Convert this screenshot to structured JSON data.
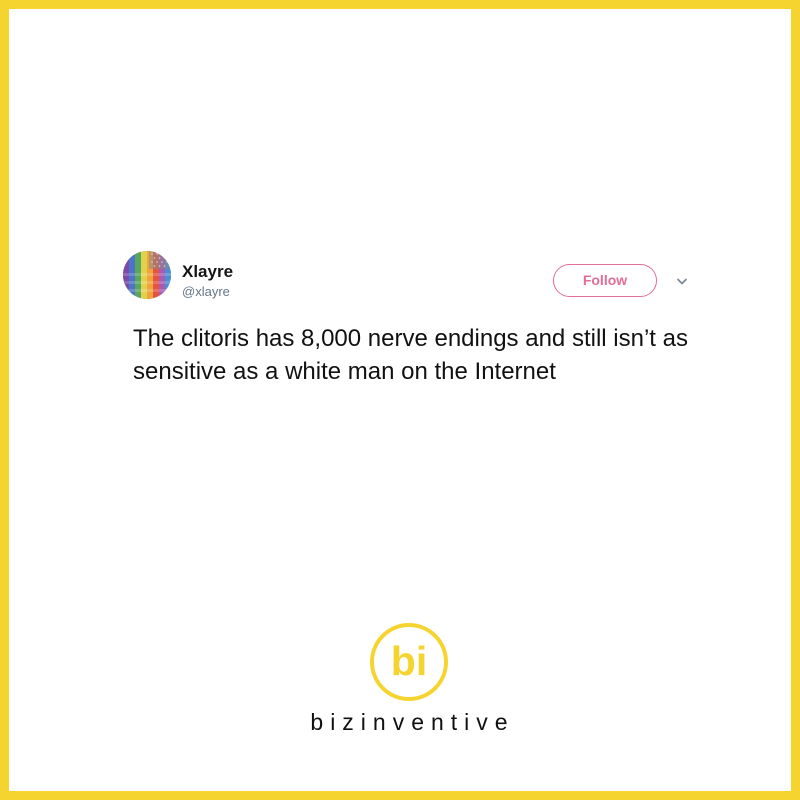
{
  "tweet": {
    "display_name": "Xlayre",
    "handle": "@xlayre",
    "follow_label": "Follow",
    "text": "The clitoris has 8,000 nerve endings and still isn’t as sensitive as a white man on the Internet"
  },
  "branding": {
    "logo_text": "bi",
    "name": "bizinventive"
  },
  "icons": {
    "avatar": "flag-avatar-icon",
    "menu": "chevron-down-icon",
    "logo": "bizinventive-logo-icon"
  },
  "colors": {
    "frame_border": "#f6d42f",
    "follow_accent": "#e46d96",
    "text": "#111111",
    "secondary_text": "#657786",
    "logo_yellow": "#f6d42f"
  }
}
